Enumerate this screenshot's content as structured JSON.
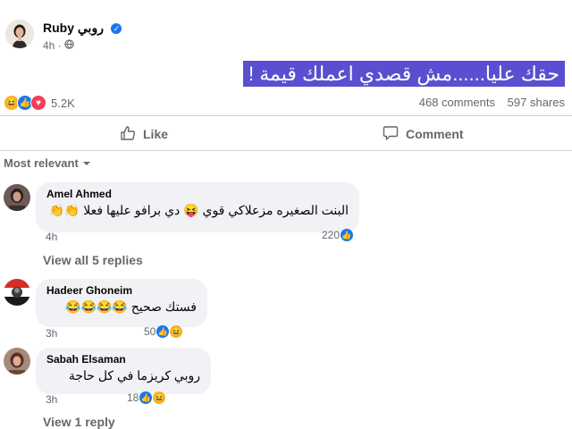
{
  "post": {
    "author": "Ruby روبي",
    "verified_badge": "✓",
    "time": "4h ·",
    "audience_icon": "globe-icon",
    "text": "حقك عليا......مش قصدي اعملك قيمة !",
    "reactions_count": "5.2K",
    "reaction_icons": [
      "haha-emoji",
      "like-emoji",
      "love-emoji"
    ],
    "comments_count": "468 comments",
    "shares_count": "597 shares"
  },
  "actions": {
    "like_label": "Like",
    "comment_label": "Comment"
  },
  "sort": {
    "label": "Most relevant"
  },
  "comments": [
    {
      "name": "Amel Ahmed",
      "text": "البنت الصغيره مزعلاكي قوي 😝 دي برافو عليها فعلا 👏👏",
      "time": "4h",
      "reacts": "220",
      "reaction_icons": [
        "like-emoji"
      ]
    },
    {
      "name": "Hadeer Ghoneim",
      "text": "فستك صحيح 😂😂😂😂",
      "time": "3h",
      "reacts": "50",
      "reaction_icons": [
        "like-emoji",
        "haha-emoji"
      ]
    },
    {
      "name": "Sabah Elsaman",
      "text": "روبي كريزما في كل حاجة",
      "time": "3h",
      "reacts": "18",
      "reaction_icons": [
        "like-emoji",
        "haha-emoji"
      ]
    }
  ],
  "links": {
    "view_replies": "View all 5 replies",
    "view_reply": "View 1 reply"
  },
  "colors": {
    "accent": "#1877f2",
    "highlight": "#5a4fd0"
  }
}
